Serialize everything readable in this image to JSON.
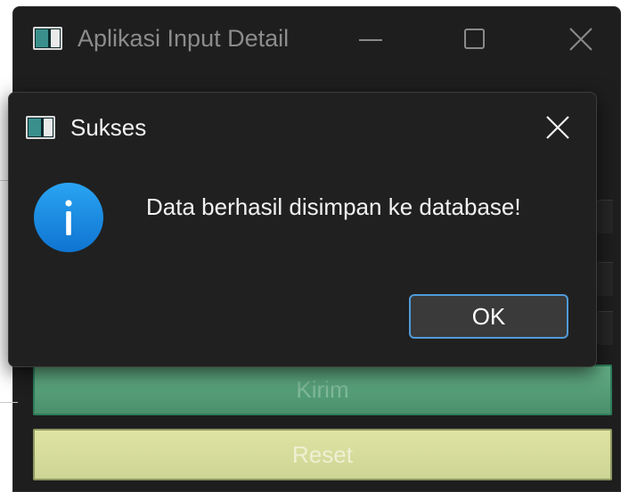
{
  "main_window": {
    "title": "Aplikasi Input Detail",
    "controls": {
      "minimize_icon": "minimize-icon",
      "maximize_icon": "maximize-icon",
      "close_icon": "close-icon"
    },
    "buttons": {
      "submit_label": "Kirim",
      "reset_label": "Reset"
    }
  },
  "dialog": {
    "title": "Sukses",
    "message": "Data berhasil disimpan ke database!",
    "ok_label": "OK",
    "icon": "info-icon"
  },
  "colors": {
    "window_bg": "#1e1e1e",
    "dialog_bg": "#202020",
    "info_blue": "#1a8ee5",
    "focus_border": "#4f9bd9",
    "submit_green": "#5aa37c",
    "reset_yellow": "#d6dc9c"
  }
}
